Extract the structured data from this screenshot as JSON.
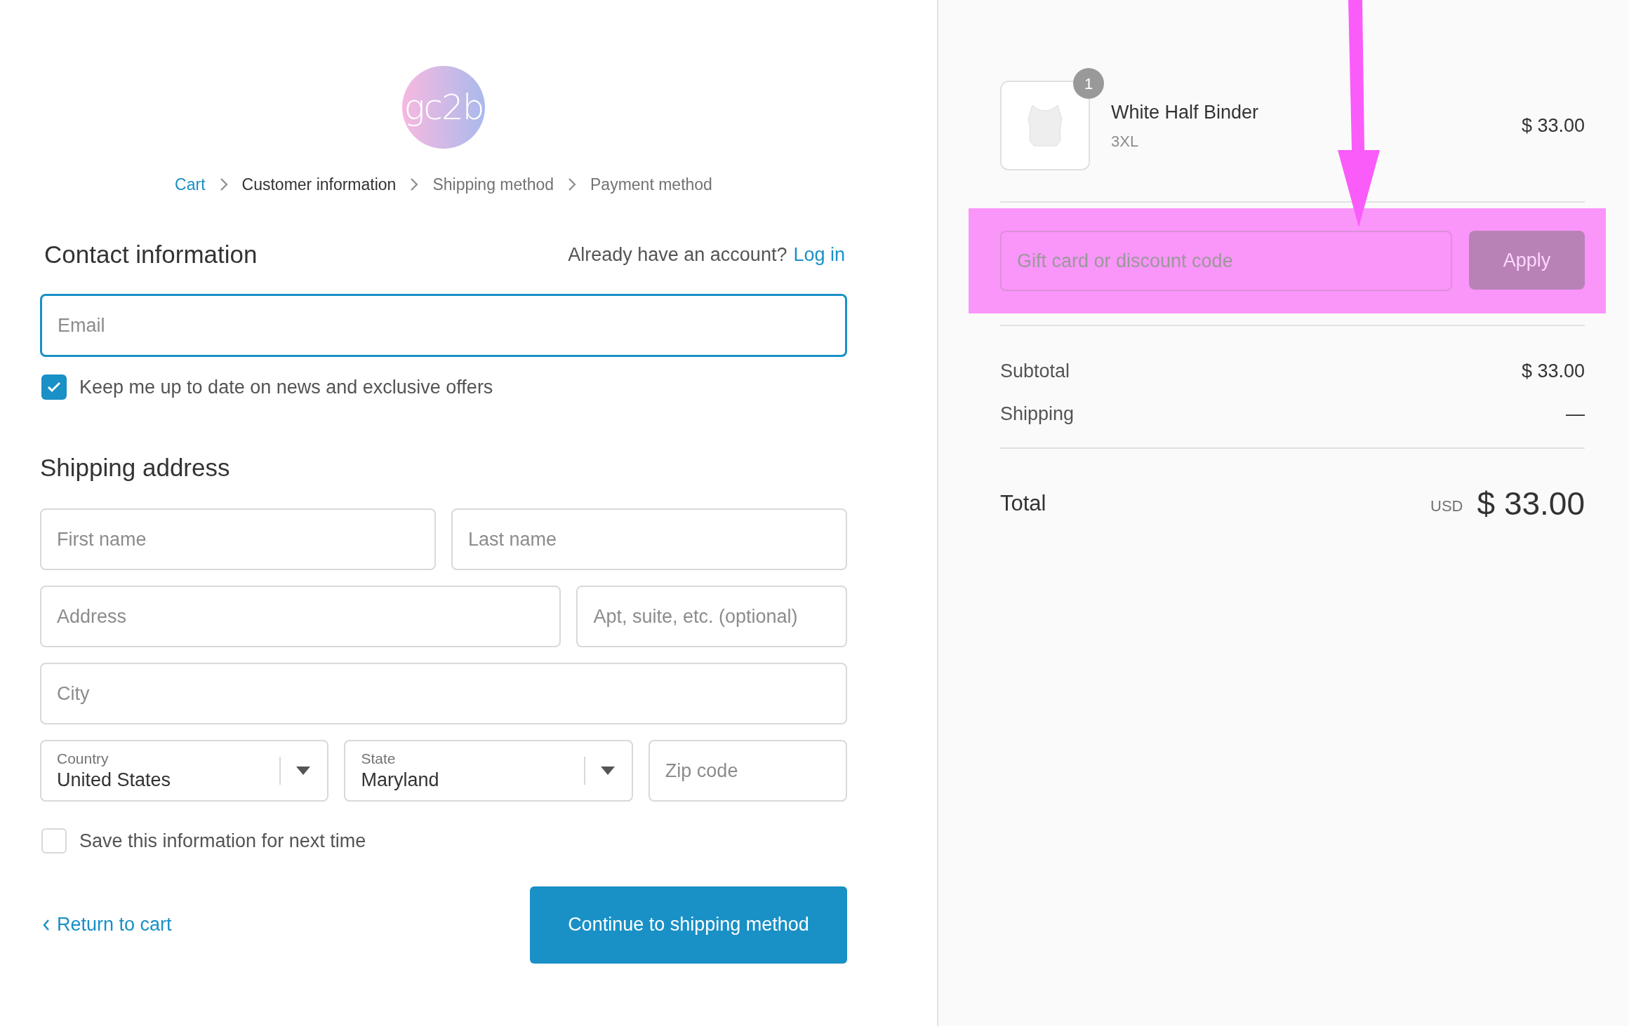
{
  "logo": {
    "text": "gc2b"
  },
  "breadcrumbs": [
    {
      "label": "Cart",
      "kind": "link"
    },
    {
      "label": "Customer information",
      "kind": "current"
    },
    {
      "label": "Shipping method",
      "kind": "upcoming"
    },
    {
      "label": "Payment method",
      "kind": "upcoming"
    }
  ],
  "contact": {
    "title": "Contact information",
    "account_prompt": "Already have an account?",
    "login_link": "Log in",
    "email": {
      "placeholder": "Email",
      "focused": true
    },
    "newsletter": {
      "label": "Keep me up to date on news and exclusive offers",
      "checked": true
    }
  },
  "shipping": {
    "title": "Shipping address",
    "fields": [
      {
        "kind": "text",
        "placeholder": "First name"
      },
      {
        "kind": "text",
        "placeholder": "Last name"
      },
      {
        "kind": "text",
        "placeholder": "Address"
      },
      {
        "kind": "text",
        "placeholder": "Apt, suite, etc. (optional)"
      },
      {
        "kind": "text",
        "placeholder": "City"
      },
      {
        "kind": "select",
        "label": "Country",
        "value": "United States"
      },
      {
        "kind": "select",
        "label": "State",
        "value": "Maryland"
      },
      {
        "kind": "text",
        "placeholder": "Zip code"
      }
    ]
  },
  "save_info": {
    "label": "Save this information for next time",
    "checked": false
  },
  "return_link": "Return to cart",
  "continue_button": "Continue to shipping method",
  "order": {
    "items": [
      {
        "name": "White Half Binder",
        "variant": "3XL",
        "quantity": "1",
        "price": "$ 33.00"
      }
    ],
    "discount": {
      "placeholder": "Gift card or discount code",
      "button": "Apply",
      "highlighted": true
    },
    "lines": [
      {
        "label": "Subtotal",
        "value": "$ 33.00"
      },
      {
        "label": "Shipping",
        "value": "—"
      }
    ],
    "total": {
      "label": "Total",
      "currency": "USD",
      "amount": "$ 33.00"
    }
  }
}
